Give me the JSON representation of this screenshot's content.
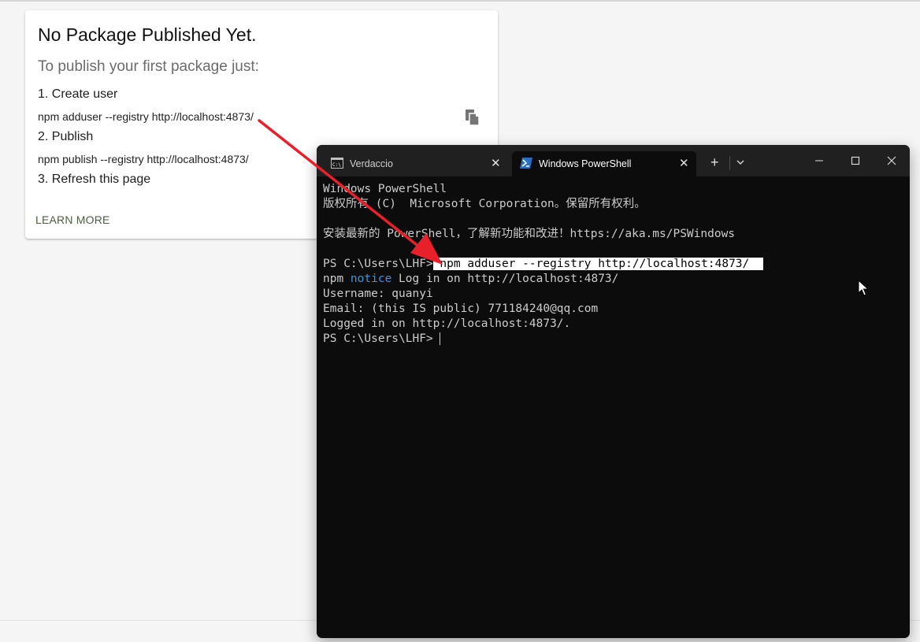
{
  "card": {
    "title": "No Package Published Yet.",
    "subtitle": "To publish your first package just:",
    "steps": [
      {
        "label": "1. Create user",
        "command": "npm adduser --registry http://localhost:4873/"
      },
      {
        "label": "2. Publish",
        "command": "npm publish --registry http://localhost:4873/"
      },
      {
        "label": "3. Refresh this page"
      }
    ],
    "learn_more": "LEARN MORE",
    "copy_icon": "copy-icon"
  },
  "terminal": {
    "tabs": [
      {
        "label": "Verdaccio",
        "icon": "cmd-icon"
      },
      {
        "label": "Windows PowerShell",
        "icon": "powershell-icon",
        "active": true
      }
    ],
    "new_tab": "+",
    "lines": {
      "l1": "Windows PowerShell",
      "l2": "版权所有 (C)  Microsoft Corporation。保留所有权利。",
      "l3": "安装最新的 PowerShell，了解新功能和改进！https://aka.ms/PSWindows",
      "prompt": "PS C:\\Users\\LHF>",
      "command": " npm adduser --registry http://localhost:4873/  ",
      "npm": "npm ",
      "notice": "notice",
      "notice_rest": " Log in on http://localhost:4873/",
      "username": "Username: quanyi",
      "email": "Email: (this IS public) 771184240@qq.com",
      "logged": "Logged in on http://localhost:4873/.",
      "prompt2": "PS C:\\Users\\LHF> "
    }
  },
  "colors": {
    "terminal_bg": "#0c0c0c",
    "tabbar_bg": "#202020",
    "notice_blue": "#3a96dd",
    "arrow_red": "#e8202a"
  }
}
